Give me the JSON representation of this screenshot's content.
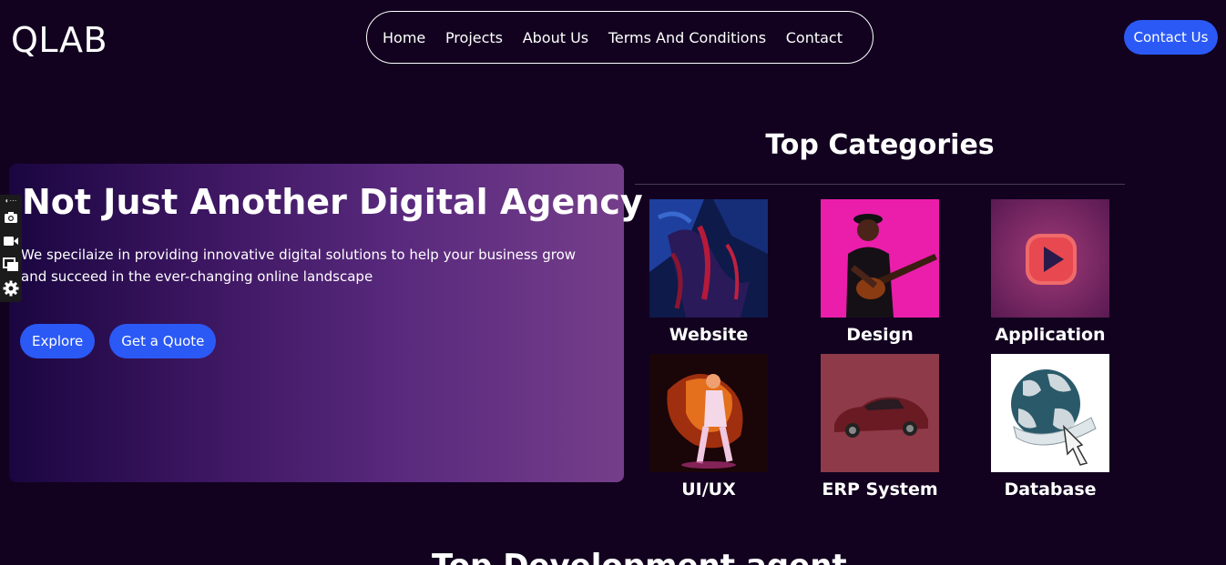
{
  "header": {
    "logo": "QLAB",
    "nav": [
      "Home",
      "Projects",
      "About Us",
      "Terms And Conditions",
      "Contact"
    ],
    "contact_button": "Contact Us"
  },
  "hero": {
    "title": "Not Just Another Digital Agency",
    "description": "We specilaize in providing innovative digital solutions to help your business grow and succeed in the ever-changing online landscape",
    "explore_button": "Explore",
    "quote_button": "Get a Quote"
  },
  "side_toolbar": {
    "icons": [
      "extension-icon",
      "camera-icon",
      "video-icon",
      "windows-icon",
      "gear-icon"
    ],
    "more": "⋯"
  },
  "categories": {
    "title": "Top Categories",
    "items": [
      {
        "label": "Website"
      },
      {
        "label": "Design"
      },
      {
        "label": "Application"
      },
      {
        "label": "UI/UX"
      },
      {
        "label": "ERP System"
      },
      {
        "label": "Database"
      }
    ]
  },
  "next_section": {
    "title": "Top Development agent"
  },
  "colors": {
    "background": "#12021f",
    "accent": "#2b59f5",
    "card_gradient_start": "#1a0640",
    "card_gradient_end": "#753e8a"
  }
}
